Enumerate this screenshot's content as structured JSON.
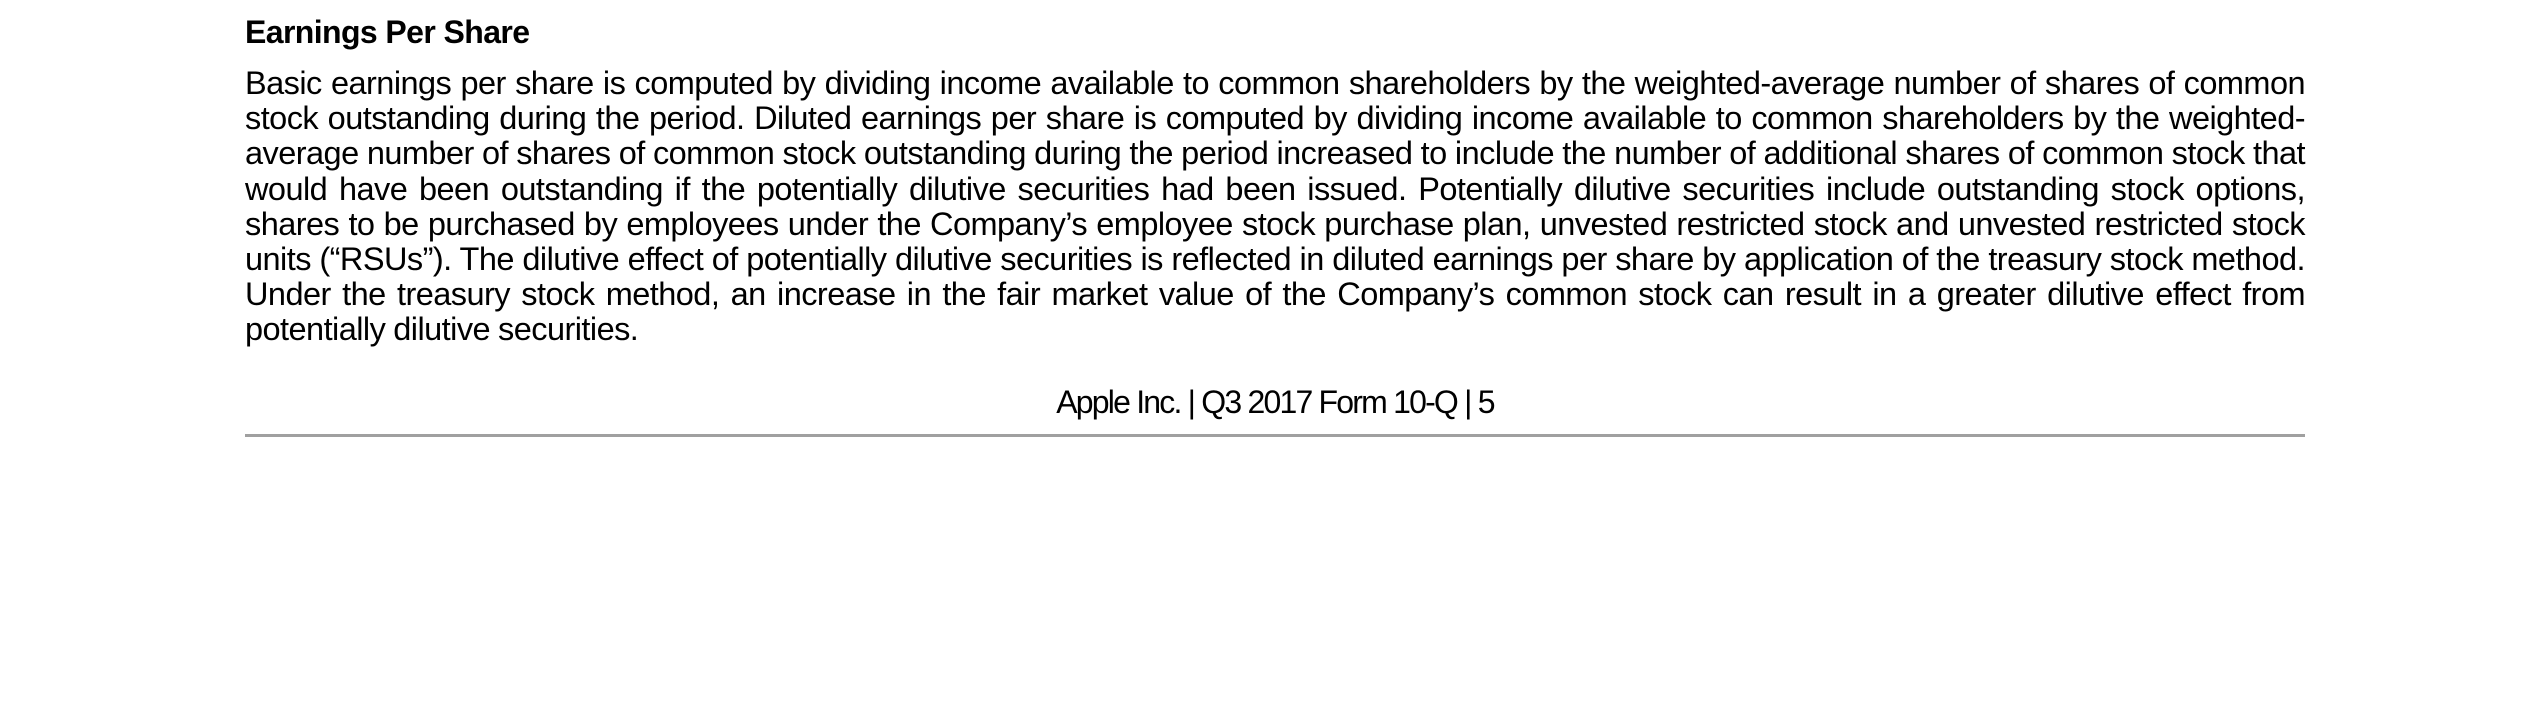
{
  "section": {
    "heading": "Earnings Per Share",
    "paragraph": "Basic earnings per share is computed by dividing income available to common shareholders by the weighted-average number of shares of common stock outstanding during the period. Diluted earnings per share is computed by dividing income available to common shareholders by the weighted-average number of shares of common stock outstanding during the period increased to include the number of additional shares of common stock that would have been outstanding if the potentially dilutive securities had been issued. Potentially dilutive securities include outstanding stock options, shares to be purchased by employees under the Company’s employee stock purchase plan, unvested restricted stock and unvested restricted stock units (“RSUs”). The dilutive effect of potentially dilutive securities is reflected in diluted earnings per share by application of the treasury stock method. Under the treasury stock method, an increase in the fair market value of the Company’s common stock can result in a greater dilutive effect from potentially dilutive securities."
  },
  "footer": {
    "text": "Apple Inc. | Q3 2017 Form 10-Q | 5"
  },
  "colors": {
    "text": "#000000",
    "rule": "#a0a0a0",
    "background": "#ffffff"
  }
}
